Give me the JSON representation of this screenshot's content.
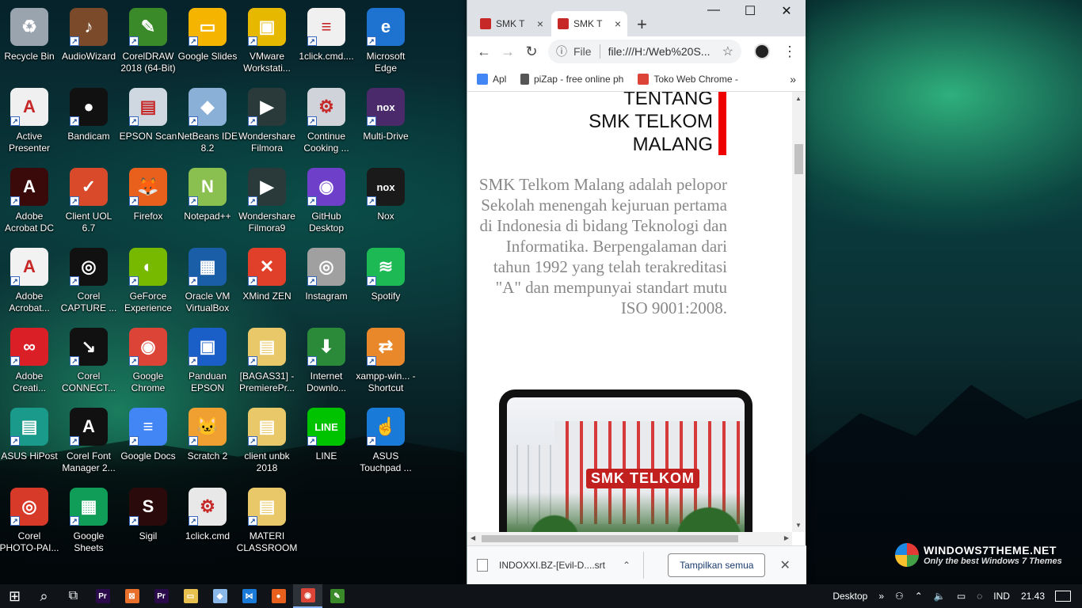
{
  "desktop": {
    "icons": [
      {
        "label": "Recycle Bin",
        "icon": "recycle-bin-icon",
        "color": "#9aa4ae",
        "glyph": "♻"
      },
      {
        "label": "AudioWizard",
        "icon": "audiowizard-icon",
        "color": "#7a4a2a",
        "glyph": "♪"
      },
      {
        "label": "CorelDRAW 2018 (64-Bit)",
        "icon": "coreldraw-icon",
        "color": "#3a8a2a",
        "glyph": "✎"
      },
      {
        "label": "Google Slides",
        "icon": "google-slides-icon",
        "color": "#f4b400",
        "glyph": "▭"
      },
      {
        "label": "VMware Workstati...",
        "icon": "vmware-icon",
        "color": "#e6b800",
        "glyph": "▣"
      },
      {
        "label": "1click.cmd....",
        "icon": "text-file-icon",
        "color": "#f0f0f0",
        "glyph": "≡"
      },
      {
        "label": "Microsoft Edge",
        "icon": "edge-icon",
        "color": "#1e73d0",
        "glyph": "e"
      },
      {
        "label": "Active Presenter",
        "icon": "active-presenter-icon",
        "color": "#f0f0f0",
        "glyph": "A"
      },
      {
        "label": "Bandicam",
        "icon": "bandicam-icon",
        "color": "#111111",
        "glyph": "●"
      },
      {
        "label": "EPSON Scan",
        "icon": "epson-scan-icon",
        "color": "#cfd8e0",
        "glyph": "▤"
      },
      {
        "label": "NetBeans IDE 8.2",
        "icon": "netbeans-icon",
        "color": "#8ab0d8",
        "glyph": "◆"
      },
      {
        "label": "Wondershare Filmora",
        "icon": "filmora-icon",
        "color": "#2a3a3a",
        "glyph": "▶"
      },
      {
        "label": "Continue Cooking ...",
        "icon": "installer-icon",
        "color": "#d0d4da",
        "glyph": "⚙"
      },
      {
        "label": "Multi-Drive",
        "icon": "nox-multi-icon",
        "color": "#4a2a6a",
        "glyph": "nox"
      },
      {
        "label": "Adobe Acrobat DC",
        "icon": "acrobat-dc-icon",
        "color": "#3a0a0a",
        "glyph": "A"
      },
      {
        "label": "Client UOL 6.7",
        "icon": "client-uol-icon",
        "color": "#d84a2a",
        "glyph": "✓"
      },
      {
        "label": "Firefox",
        "icon": "firefox-icon",
        "color": "#e8601c",
        "glyph": "🦊"
      },
      {
        "label": "Notepad++",
        "icon": "notepadpp-icon",
        "color": "#8ac050",
        "glyph": "N"
      },
      {
        "label": "Wondershare Filmora9",
        "icon": "filmora9-icon",
        "color": "#2a3a3a",
        "glyph": "▶"
      },
      {
        "label": "GitHub Desktop",
        "icon": "github-desktop-icon",
        "color": "#6e40c9",
        "glyph": "◉"
      },
      {
        "label": "Nox",
        "icon": "nox-icon",
        "color": "#1a1a1a",
        "glyph": "nox"
      },
      {
        "label": "Adobe Acrobat...",
        "icon": "acrobat-reader-icon",
        "color": "#f2f2f2",
        "glyph": "A"
      },
      {
        "label": "Corel CAPTURE ...",
        "icon": "corel-capture-icon",
        "color": "#111111",
        "glyph": "◎"
      },
      {
        "label": "GeForce Experience",
        "icon": "geforce-icon",
        "color": "#76b900",
        "glyph": "◐"
      },
      {
        "label": "Oracle VM VirtualBox",
        "icon": "virtualbox-icon",
        "color": "#1a5ea8",
        "glyph": "▦"
      },
      {
        "label": "XMind ZEN",
        "icon": "xmind-icon",
        "color": "#e0402a",
        "glyph": "✕"
      },
      {
        "label": "Instagram",
        "icon": "instagram-icon",
        "color": "#a0a0a0",
        "glyph": "◎"
      },
      {
        "label": "Spotify",
        "icon": "spotify-icon",
        "color": "#1db954",
        "glyph": "≋"
      },
      {
        "label": "Adobe Creati...",
        "icon": "creative-cloud-icon",
        "color": "#da1f26",
        "glyph": "∞"
      },
      {
        "label": "Corel CONNECT...",
        "icon": "corel-connect-icon",
        "color": "#111111",
        "glyph": "↘"
      },
      {
        "label": "Google Chrome",
        "icon": "chrome-icon",
        "color": "#db4437",
        "glyph": "◉"
      },
      {
        "label": "Panduan EPSON",
        "icon": "panduan-epson-icon",
        "color": "#1a5ec8",
        "glyph": "▣"
      },
      {
        "label": "[BAGAS31] - PremierePr...",
        "icon": "folder-icon",
        "color": "#e8c868",
        "glyph": "▤"
      },
      {
        "label": "Internet Downlo...",
        "icon": "idm-icon",
        "color": "#2a8a3a",
        "glyph": "⬇"
      },
      {
        "label": "xampp-win... - Shortcut",
        "icon": "xampp-icon",
        "color": "#e8882a",
        "glyph": "⇄"
      },
      {
        "label": "ASUS HiPost",
        "icon": "asus-hipost-icon",
        "color": "#1a9a8a",
        "glyph": "▤"
      },
      {
        "label": "Corel Font Manager 2...",
        "icon": "corel-font-icon",
        "color": "#111111",
        "glyph": "A"
      },
      {
        "label": "Google Docs",
        "icon": "google-docs-icon",
        "color": "#4285f4",
        "glyph": "≡"
      },
      {
        "label": "Scratch 2",
        "icon": "scratch-icon",
        "color": "#f0a030",
        "glyph": "🐱"
      },
      {
        "label": "client unbk 2018",
        "icon": "folder-icon",
        "color": "#e8c868",
        "glyph": "▤"
      },
      {
        "label": "LINE",
        "icon": "line-icon",
        "color": "#00c300",
        "glyph": "LINE"
      },
      {
        "label": "ASUS Touchpad ...",
        "icon": "asus-touchpad-icon",
        "color": "#1a7ad8",
        "glyph": "☝"
      },
      {
        "label": "Corel PHOTO-PAI...",
        "icon": "corel-photopaint-icon",
        "color": "#d83a2a",
        "glyph": "◎"
      },
      {
        "label": "Google Sheets",
        "icon": "google-sheets-icon",
        "color": "#0f9d58",
        "glyph": "▦"
      },
      {
        "label": "Sigil",
        "icon": "sigil-icon",
        "color": "#2a0a0a",
        "glyph": "S"
      },
      {
        "label": "1click.cmd",
        "icon": "cmd-file-icon",
        "color": "#e8e8e8",
        "glyph": "⚙"
      },
      {
        "label": "MATERI CLASSROOM",
        "icon": "folder-icon",
        "color": "#e8c868",
        "glyph": "▤"
      }
    ]
  },
  "browser": {
    "tabs": [
      {
        "title": "SMK T",
        "close": "×"
      },
      {
        "title": "SMK T",
        "close": "×"
      }
    ],
    "new_tab": "+",
    "window_controls": {
      "minimize": "—",
      "maximize": "☐",
      "close": "✕"
    },
    "nav": {
      "back": "←",
      "forward": "→",
      "reload": "↻"
    },
    "omnibox": {
      "info": "ⓘ",
      "scheme": "File",
      "url": "file:///H:/Web%20S...",
      "star": "☆"
    },
    "menu": "⋮",
    "bookmarks": [
      {
        "label": "Apl",
        "color": "#4285f4"
      },
      {
        "label": "piZap - free online ph",
        "color": "#555555"
      },
      {
        "label": "Toko Web Chrome - ",
        "color": "#db4437"
      }
    ],
    "bookmarks_more": "»",
    "page": {
      "heading_lines": [
        "TENTANG",
        "SMK TELKOM",
        "MALANG"
      ],
      "paragraph": "SMK Telkom Malang adalah pelopor Sekolah menengah kejuruan pertama di Indonesia di bidang Teknologi dan Informatika. Berpengalaman dari tahun 1992 yang telah terakreditasi \"A\" dan mempunyai standart mutu ISO 9001:2008.",
      "photo_sign": "SMK TELKOM",
      "accent_color": "#e00000"
    },
    "download_bar": {
      "filename": "INDOXXI.BZ-[Evil-D....srt",
      "chevron": "⌃",
      "show_all": "Tampilkan semua",
      "close": "✕"
    }
  },
  "watermark": {
    "title": "WINDOWS7THEME.NET",
    "subtitle": "Only the best Windows 7 Themes"
  },
  "taskbar": {
    "start": "⊞",
    "search": "⌕",
    "task_view": "⧉",
    "apps": [
      {
        "name": "premiere-app",
        "color": "#2a0a4a",
        "glyph": "Pr"
      },
      {
        "name": "xampp-app",
        "color": "#e8702a",
        "glyph": "⊠"
      },
      {
        "name": "premiere-app-2",
        "color": "#2a0a4a",
        "glyph": "Pr"
      },
      {
        "name": "file-explorer-app",
        "color": "#e8c050",
        "glyph": "▭"
      },
      {
        "name": "3d-app",
        "color": "#8ab8e8",
        "glyph": "◆"
      },
      {
        "name": "vscode-app",
        "color": "#1a7ad8",
        "glyph": "⋈"
      },
      {
        "name": "firefox-app",
        "color": "#e8601c",
        "glyph": "●"
      },
      {
        "name": "chrome-app",
        "color": "#db4437",
        "glyph": "◉"
      },
      {
        "name": "coreldraw-app",
        "color": "#3a8a2a",
        "glyph": "✎"
      }
    ],
    "desktop_label": "Desktop",
    "desktop_chevron": "»",
    "tray_icons": [
      "⚇",
      "⌃",
      "🔈",
      "▭",
      "◌"
    ],
    "language": "IND",
    "clock": "21.43",
    "notifications": "▭"
  }
}
